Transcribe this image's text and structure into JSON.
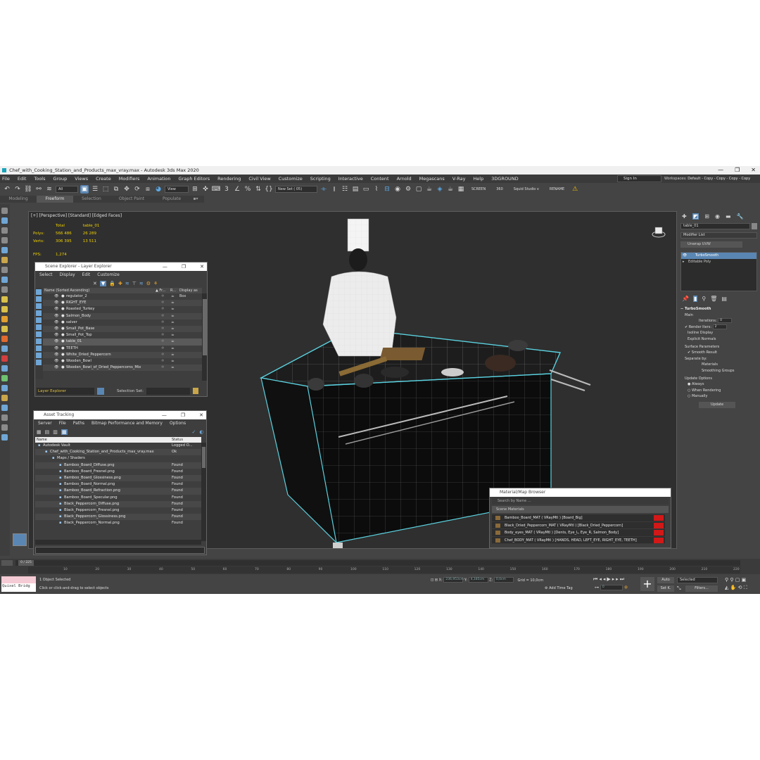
{
  "window": {
    "title": "Chef_with_Cooking_Station_and_Products_max_vray.max - Autodesk 3ds Max 2020",
    "minimize": "—",
    "maximize": "❐",
    "close": "✕"
  },
  "menu": [
    "File",
    "Edit",
    "Tools",
    "Group",
    "Views",
    "Create",
    "Modifiers",
    "Animation",
    "Graph Editors",
    "Rendering",
    "Civil View",
    "Customize",
    "Scripting",
    "Interactive",
    "Content",
    "Arnold",
    "Megascans",
    "V-Ray",
    "Help",
    "3DGROUND"
  ],
  "signin": "Sign In",
  "workspace": {
    "label": "Workspaces:",
    "value": "Default - Copy - Copy - Copy - Copy"
  },
  "toolbar": {
    "filter_dropdown": "All",
    "refcoord_dropdown": "View",
    "selection_set": "New Set ( 05)",
    "screen": "SCREEN",
    "deg": "360",
    "squid": "Squid Studio v",
    "rename": "RENAME"
  },
  "ribbon": {
    "tabs": [
      "Modeling",
      "Freeform",
      "Selection",
      "Object Paint",
      "Populate"
    ]
  },
  "viewport": {
    "label": "[+] [Perspective] [Standard] [Edged Faces]",
    "stats": {
      "total_label": "Total",
      "object_label": "table_01",
      "polys_label": "Polys:",
      "polys_total": "566 486",
      "polys_obj": "26 289",
      "verts_label": "Verts:",
      "verts_total": "306 395",
      "verts_obj": "13 511",
      "fps_label": "FPS:",
      "fps_value": "1,274"
    }
  },
  "scene_explorer": {
    "title": "Scene Explorer - Layer Explorer",
    "menu": [
      "Select",
      "Display",
      "Edit",
      "Customize"
    ],
    "col_name": "Name (Sorted Ascending)",
    "col_fr": "▲ Fr...",
    "col_r": "R...",
    "col_box": "Display as Box",
    "rows": [
      "regulator_2",
      "RIGHT_EYE",
      "Roasted_Turkey",
      "Salmon_Body",
      "salver",
      "Small_Pot_Base",
      "Small_Pot_Top",
      "table_01",
      "TEETH",
      "White_Dried_Peppercorn",
      "Wooden_Bowl",
      "Wooden_Bowl_of_Dried_Peppercorns_Mix"
    ],
    "selected_index": 7,
    "footer_explorer": "Layer Explorer",
    "footer_selset": "Selection Set:"
  },
  "asset_tracking": {
    "title": "Asset Tracking",
    "menu": [
      "Server",
      "File",
      "Paths",
      "Bitmap Performance and Memory",
      "Options"
    ],
    "col_name": "Name",
    "col_status": "Status",
    "rows": [
      {
        "name": "Autodesk Vault",
        "status": "Logged O...",
        "indent": 0
      },
      {
        "name": "Chef_with_Cooking_Station_and_Products_max_vray.max",
        "status": "Ok",
        "indent": 1
      },
      {
        "name": "Maps / Shaders",
        "status": "",
        "indent": 2
      },
      {
        "name": "Bamboo_Board_Diffuse.png",
        "status": "Found",
        "indent": 3
      },
      {
        "name": "Bamboo_Board_Fresnel.png",
        "status": "Found",
        "indent": 3
      },
      {
        "name": "Bamboo_Board_Glossiness.png",
        "status": "Found",
        "indent": 3
      },
      {
        "name": "Bamboo_Board_Normal.png",
        "status": "Found",
        "indent": 3
      },
      {
        "name": "Bamboo_Board_Refraction.png",
        "status": "Found",
        "indent": 3
      },
      {
        "name": "Bamboo_Board_Specular.png",
        "status": "Found",
        "indent": 3
      },
      {
        "name": "Black_Peppercorn_Diffuse.png",
        "status": "Found",
        "indent": 3
      },
      {
        "name": "Black_Peppercorn_Fresnel.png",
        "status": "Found",
        "indent": 3
      },
      {
        "name": "Black_Peppercorn_Glossiness.png",
        "status": "Found",
        "indent": 3
      },
      {
        "name": "Black_Peppercorn_Normal.png",
        "status": "Found",
        "indent": 3
      }
    ]
  },
  "material_browser": {
    "title": "Material/Map Browser",
    "search": "Search by Name ...",
    "section": "Scene Materials",
    "rows": [
      "Bamboo_Board_MAT  ( VRayMtl )  [Board_Big]",
      "Black_Dried_Peppercorn_MAT  ( VRayMtl )  [Black_Dried_Peppercorn]",
      "Body_eyes_MAT  ( VRayMtl )  [Dents, Eye_L, Eye_R, Salmon_Body]",
      "Chef_BODY_MAT  ( VRayMtl )  [HANDS, HEAD, LEFT_EYE, RIGHT_EYE, TEETH]"
    ]
  },
  "command_panel": {
    "object_name": "table_01",
    "modifier_list": "Modifier List",
    "unwrap": "Unwrap UVW",
    "stack": [
      "TurboSmooth",
      "Editable Poly"
    ],
    "rollout_title": "TurboSmooth",
    "main": "Main",
    "iterations_label": "Iterations:",
    "iterations": "0",
    "render_iters_label": "Render Iters:",
    "render_iters": "2",
    "isoline": "Isoline Display",
    "explicit": "Explicit Normals",
    "surface": "Surface Parameters",
    "smooth_result": "Smooth Result",
    "separate": "Separate by:",
    "materials": "Materials",
    "smoothing": "Smoothing Groups",
    "update_options": "Update Options",
    "always": "Always",
    "when_rendering": "When Rendering",
    "manually": "Manually",
    "update": "Update"
  },
  "timeline": {
    "frame": "0 / 225",
    "ticks": [
      "10",
      "20",
      "30",
      "40",
      "50",
      "60",
      "70",
      "80",
      "90",
      "100",
      "110",
      "120",
      "130",
      "140",
      "150",
      "160",
      "170",
      "180",
      "190",
      "200",
      "210",
      "220"
    ]
  },
  "status": {
    "quixel": "Quixel Bridg",
    "selected": "1 Object Selected",
    "hint": "Click or click-and-drag to select objects",
    "x_label": "X:",
    "x_val": "236,953cm",
    "y_label": "Y:",
    "y_val": "4,185cm",
    "z_label": "Z:",
    "z_val": "0,0cm",
    "grid": "Grid = 10,0cm",
    "add_time_tag": "Add Time Tag",
    "auto": "Auto",
    "selected_dd": "Selected",
    "setk": "Set K.",
    "filters": "Filters...",
    "frame_field": "0"
  }
}
